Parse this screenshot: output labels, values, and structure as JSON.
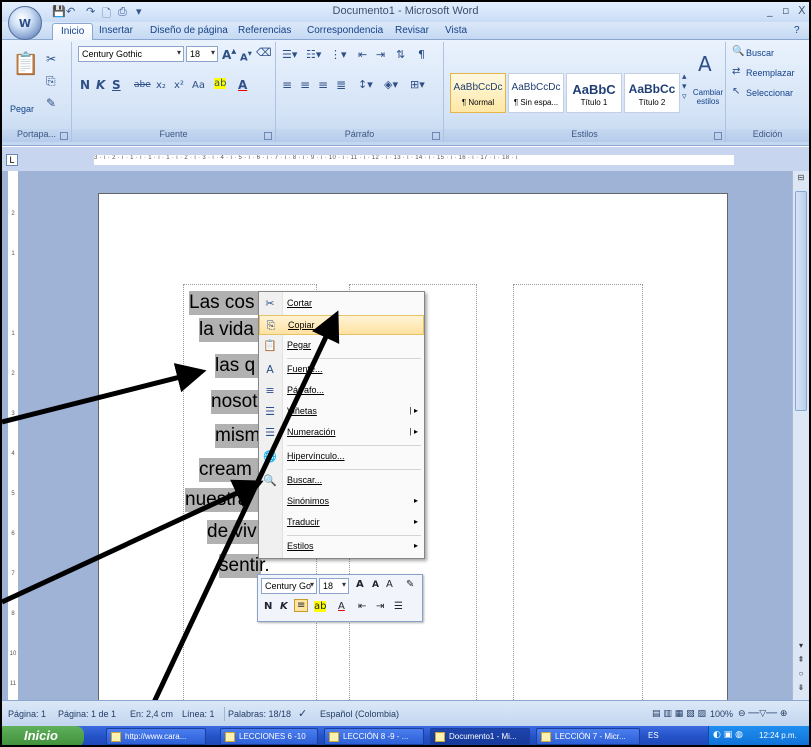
{
  "titlebar": {
    "title": "Documento1 - Microsoft Word",
    "office_button": "W",
    "controls": [
      "_",
      "▫",
      "X"
    ]
  },
  "tabs": [
    "Inicio",
    "Insertar",
    "Diseño de página",
    "Referencias",
    "Correspondencia",
    "Revisar",
    "Vista"
  ],
  "ribbon": {
    "clipboard": {
      "paste": "Pegar",
      "label": "Portapa..."
    },
    "font": {
      "family": "Century Gothic",
      "size": "18",
      "label": "Fuente",
      "format_buttons": [
        "N",
        "K",
        "S",
        "abe",
        "x₂",
        "x²",
        "Aa"
      ]
    },
    "paragraph": {
      "label": "Párrafo"
    },
    "styles": {
      "label": "Estilos",
      "items": [
        {
          "sample": "AaBbCcDc",
          "name": "¶ Normal"
        },
        {
          "sample": "AaBbCcDc",
          "name": "¶ Sin espa..."
        },
        {
          "sample": "AaBbC",
          "name": "Título 1"
        },
        {
          "sample": "AaBbCc",
          "name": "Título 2"
        }
      ],
      "change": "Cambiar estilos"
    },
    "editing": {
      "label": "Edición",
      "find": "Buscar",
      "replace": "Reemplazar",
      "select": "Seleccionar"
    }
  },
  "ruler": {
    "text": "3 · ı · 2 · ı · 1 · ı · 1 · ı · 1 · ı · 2 · ı · 3 · ı · 4 · ı · 5 · ı · 6 · ı · 7 · ı · 8 · ı · 9 · ı · 10 · ı · 11 · ı · 12 · ı · 13 · ı · 14 · ı · 15 · ı · 16 · ı · 17 · ı · 18 · ı",
    "tab_selector": "L"
  },
  "document": {
    "lines": [
      "Las cos",
      "la vida",
      "las q",
      "nosot",
      "mism",
      "cream",
      "nuestra",
      "de viv",
      "sentir."
    ]
  },
  "context_menu": [
    {
      "icon": "✂",
      "label": "Cortar",
      "submenu": false
    },
    {
      "icon": "⎘",
      "label": "Copiar",
      "submenu": false
    },
    {
      "icon": "📋",
      "label": "Pegar",
      "submenu": false
    },
    {
      "icon": "A",
      "label": "Fuente...",
      "submenu": false
    },
    {
      "icon": "≡",
      "label": "Párrafo...",
      "submenu": false
    },
    {
      "icon": "☰",
      "label": "Viñetas",
      "submenu": true
    },
    {
      "icon": "☰",
      "label": "Numeración",
      "submenu": true
    },
    {
      "icon": "🌐",
      "label": "Hipervínculo...",
      "submenu": false
    },
    {
      "icon": "🔍",
      "label": "Buscar...",
      "submenu": false
    },
    {
      "icon": "",
      "label": "Sinónimos",
      "submenu": true
    },
    {
      "icon": "",
      "label": "Traducir",
      "submenu": true
    },
    {
      "icon": "",
      "label": "Estilos",
      "submenu": true
    }
  ],
  "mini_toolbar": {
    "font": "Century Go",
    "size": "18",
    "buttons_row1": [
      "A",
      "A",
      "A",
      "✎"
    ],
    "buttons_row2": [
      "N",
      "K",
      "≡",
      "ab",
      "A",
      "⇤",
      "⇥",
      "☰"
    ]
  },
  "statusbar": {
    "page": "Página: 1",
    "pages": "Página: 1 de 1",
    "position": "En: 2,4 cm",
    "line": "Línea: 1",
    "words": "Palabras: 18/18",
    "language": "Español (Colombia)",
    "zoom": "100%"
  },
  "taskbar": {
    "start": "Inicio",
    "tasks": [
      {
        "label": "http://www.cara...",
        "active": false
      },
      {
        "label": "LECCIONES 6 -10",
        "active": false
      },
      {
        "label": "LECCIÓN 8 -9 - ...",
        "active": false
      },
      {
        "label": "Documento1 - Mi...",
        "active": true
      },
      {
        "label": "LECCIÓN 7 - Micr...",
        "active": false
      }
    ],
    "lang": "ES",
    "clock": "12:24 p.m."
  },
  "colors": {
    "ribbon": "#d4e3f6",
    "selection": "#b1b1b1",
    "menu_hover": "#ffe1a0",
    "taskbar": "#2452c7"
  }
}
